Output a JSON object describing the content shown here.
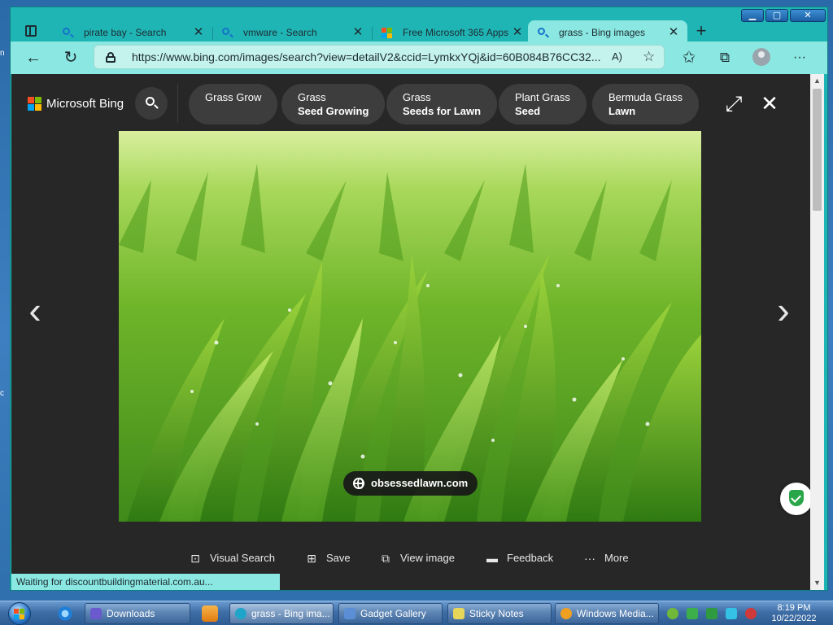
{
  "window": {
    "minimize": "▁",
    "maximize": "▢",
    "close": "✕"
  },
  "tabs": [
    {
      "title": "pirate bay - Search",
      "icon": "bing-search-icon"
    },
    {
      "title": "vmware - Search",
      "icon": "bing-search-icon"
    },
    {
      "title": "Free Microsoft 365 Apps",
      "icon": "microsoft-logo-icon"
    },
    {
      "title": "grass - Bing images",
      "icon": "bing-search-icon",
      "active": true
    }
  ],
  "tab_close": "✕",
  "new_tab": "+",
  "toolbar": {
    "back": "←",
    "refresh": "↻",
    "url": "https://www.bing.com/images/search?view=detailV2&ccid=LymkxYQj&id=60B084B76CC32...",
    "read_aloud": "A)",
    "favorites_add": "☆",
    "favorites": "✩",
    "collections": "⧉",
    "menu": "···"
  },
  "bing": {
    "brand": "Microsoft Bing",
    "chips": [
      {
        "line1": "Grass Grow",
        "line2": ""
      },
      {
        "line1": "Grass",
        "line2": "Seed Growing"
      },
      {
        "line1": "Grass",
        "line2": "Seeds for Lawn"
      },
      {
        "line1": "Plant Grass",
        "line2": "Seed"
      },
      {
        "line1": "Bermuda Grass",
        "line2": "Lawn"
      }
    ],
    "expand": "⤢",
    "close": "✕",
    "prev": "‹",
    "next": "›",
    "source": "obsessedlawn.com",
    "actions": [
      {
        "label": "Visual Search",
        "icon": "⊡"
      },
      {
        "label": "Save",
        "icon": "⊞"
      },
      {
        "label": "View image",
        "icon": "⧉"
      },
      {
        "label": "Feedback",
        "icon": "▬"
      },
      {
        "label": "More",
        "icon": "···"
      }
    ]
  },
  "status": "Waiting for discountbuildingmaterial.com.au...",
  "taskbar": {
    "tasks": [
      {
        "label": "Downloads"
      },
      {
        "label": "grass - Bing ima..."
      },
      {
        "label": "Gadget Gallery"
      },
      {
        "label": "Sticky Notes"
      },
      {
        "label": "Windows Media..."
      }
    ],
    "time": "8:19 PM",
    "date": "10/22/2022"
  },
  "colors": {
    "edge_theme": "#20b5b5",
    "toolbar": "#8ae7e1",
    "bing_bg": "#272727",
    "chip": "#3d3d3d",
    "shield_green": "#2aa64a"
  }
}
